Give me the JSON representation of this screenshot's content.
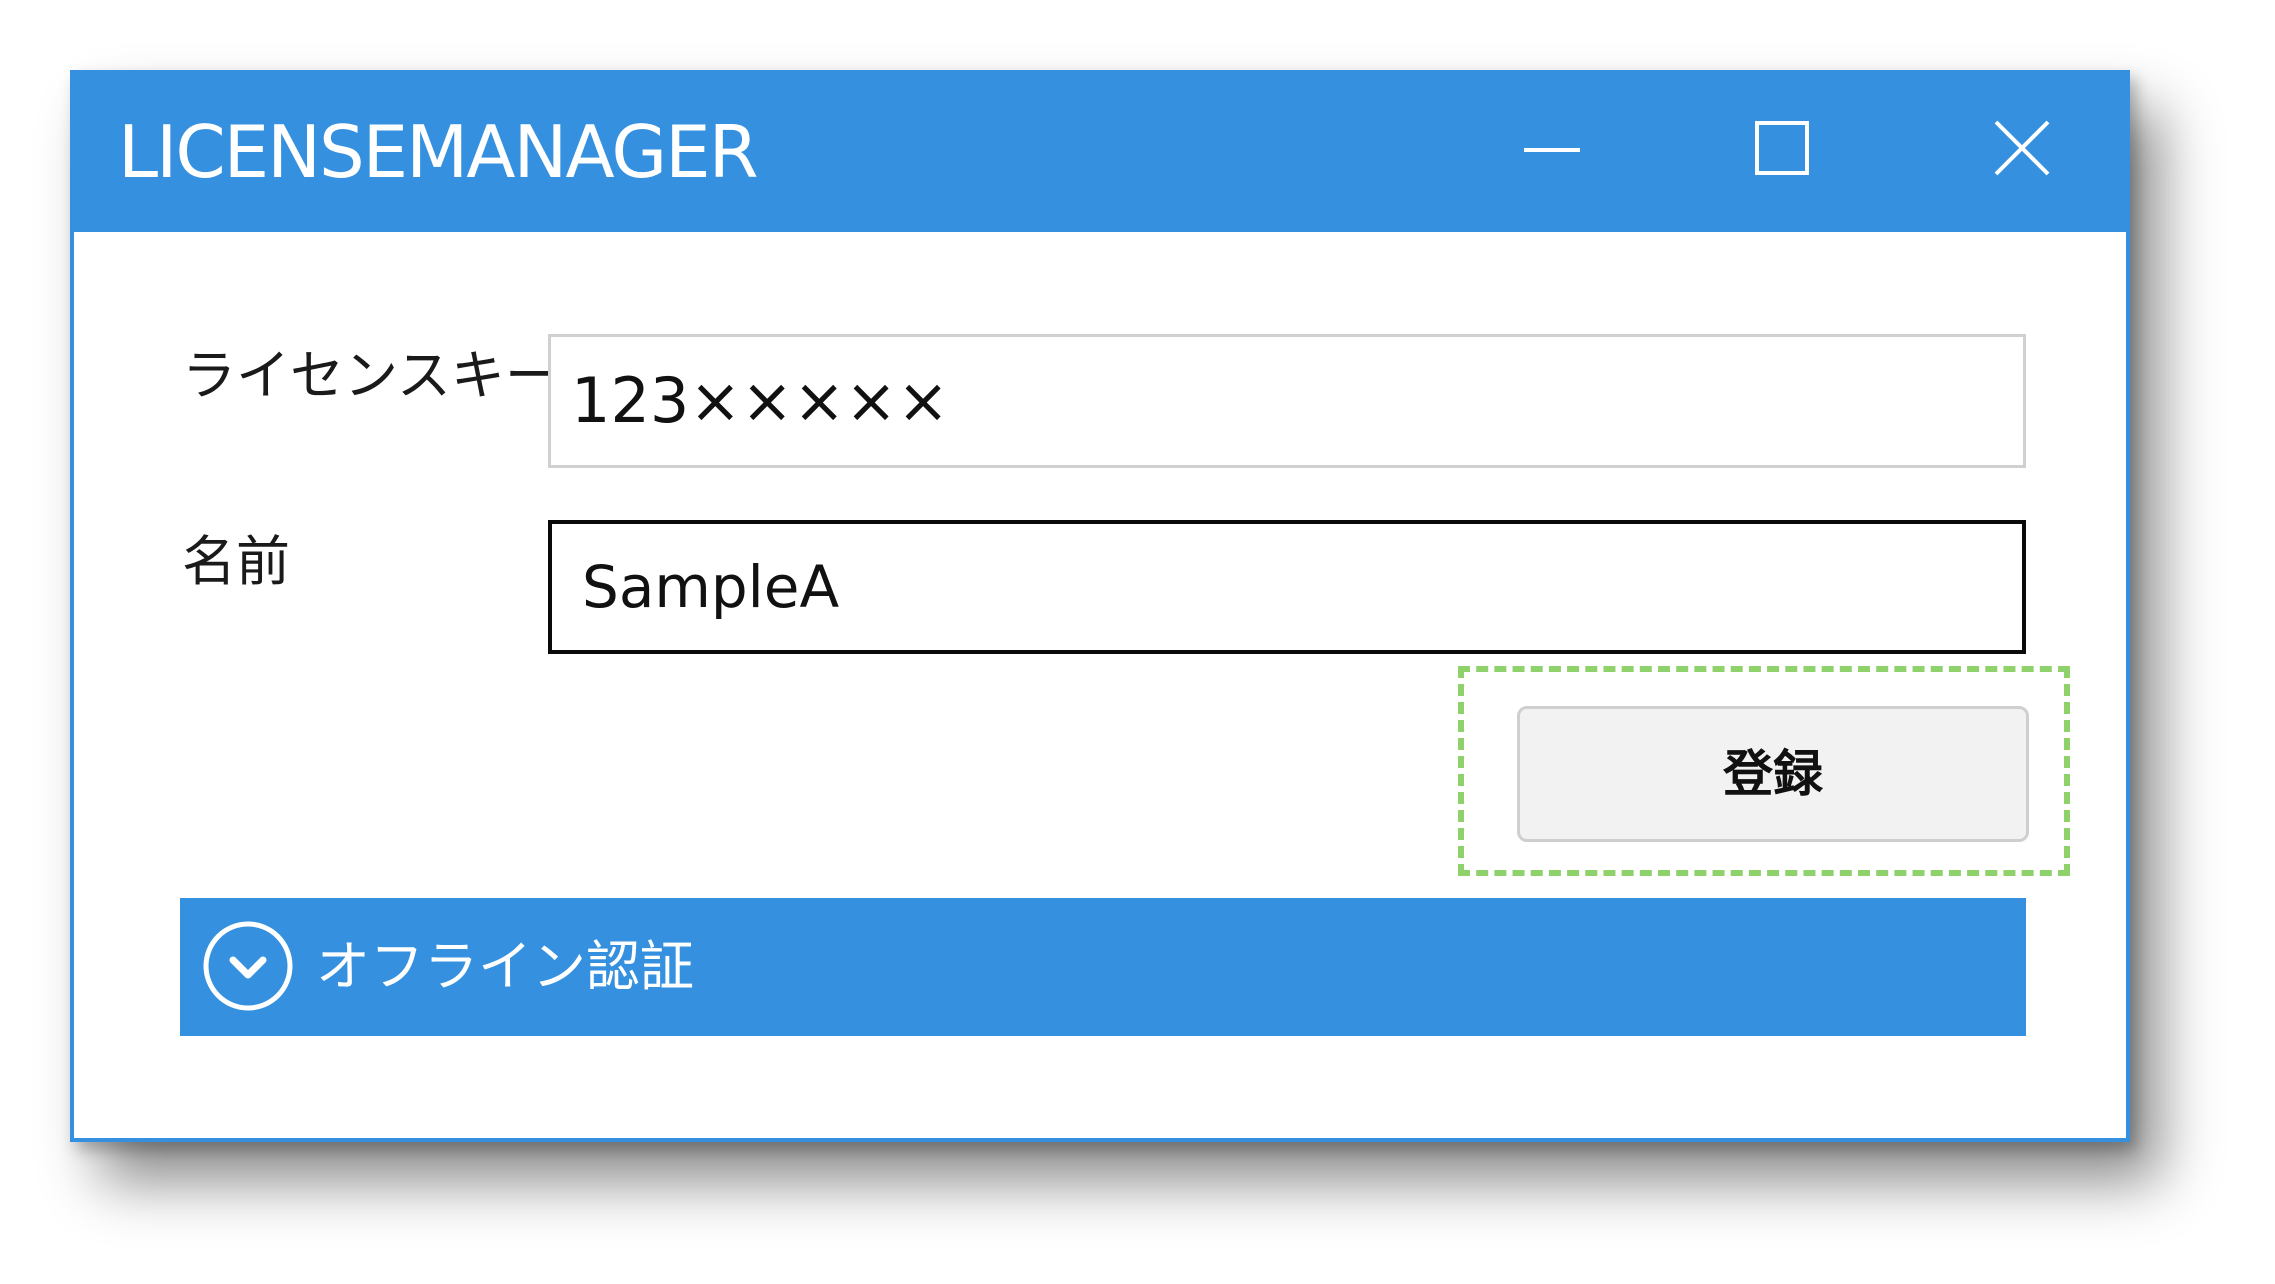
{
  "window": {
    "title": "LICENSEMANAGER",
    "controls": {
      "minimize_icon": "minimize-icon",
      "maximize_icon": "maximize-icon",
      "close_icon": "close-icon"
    },
    "accent_color": "#3591df"
  },
  "form": {
    "license_key_label": "ライセンスキー",
    "license_key_value": "123×××××",
    "name_label": "名前",
    "name_value": "SampleA",
    "register_label": "登録",
    "highlight_color": "#8fd16a"
  },
  "offline": {
    "label": "オフライン認証",
    "icon": "chevron-down-circle-icon"
  }
}
